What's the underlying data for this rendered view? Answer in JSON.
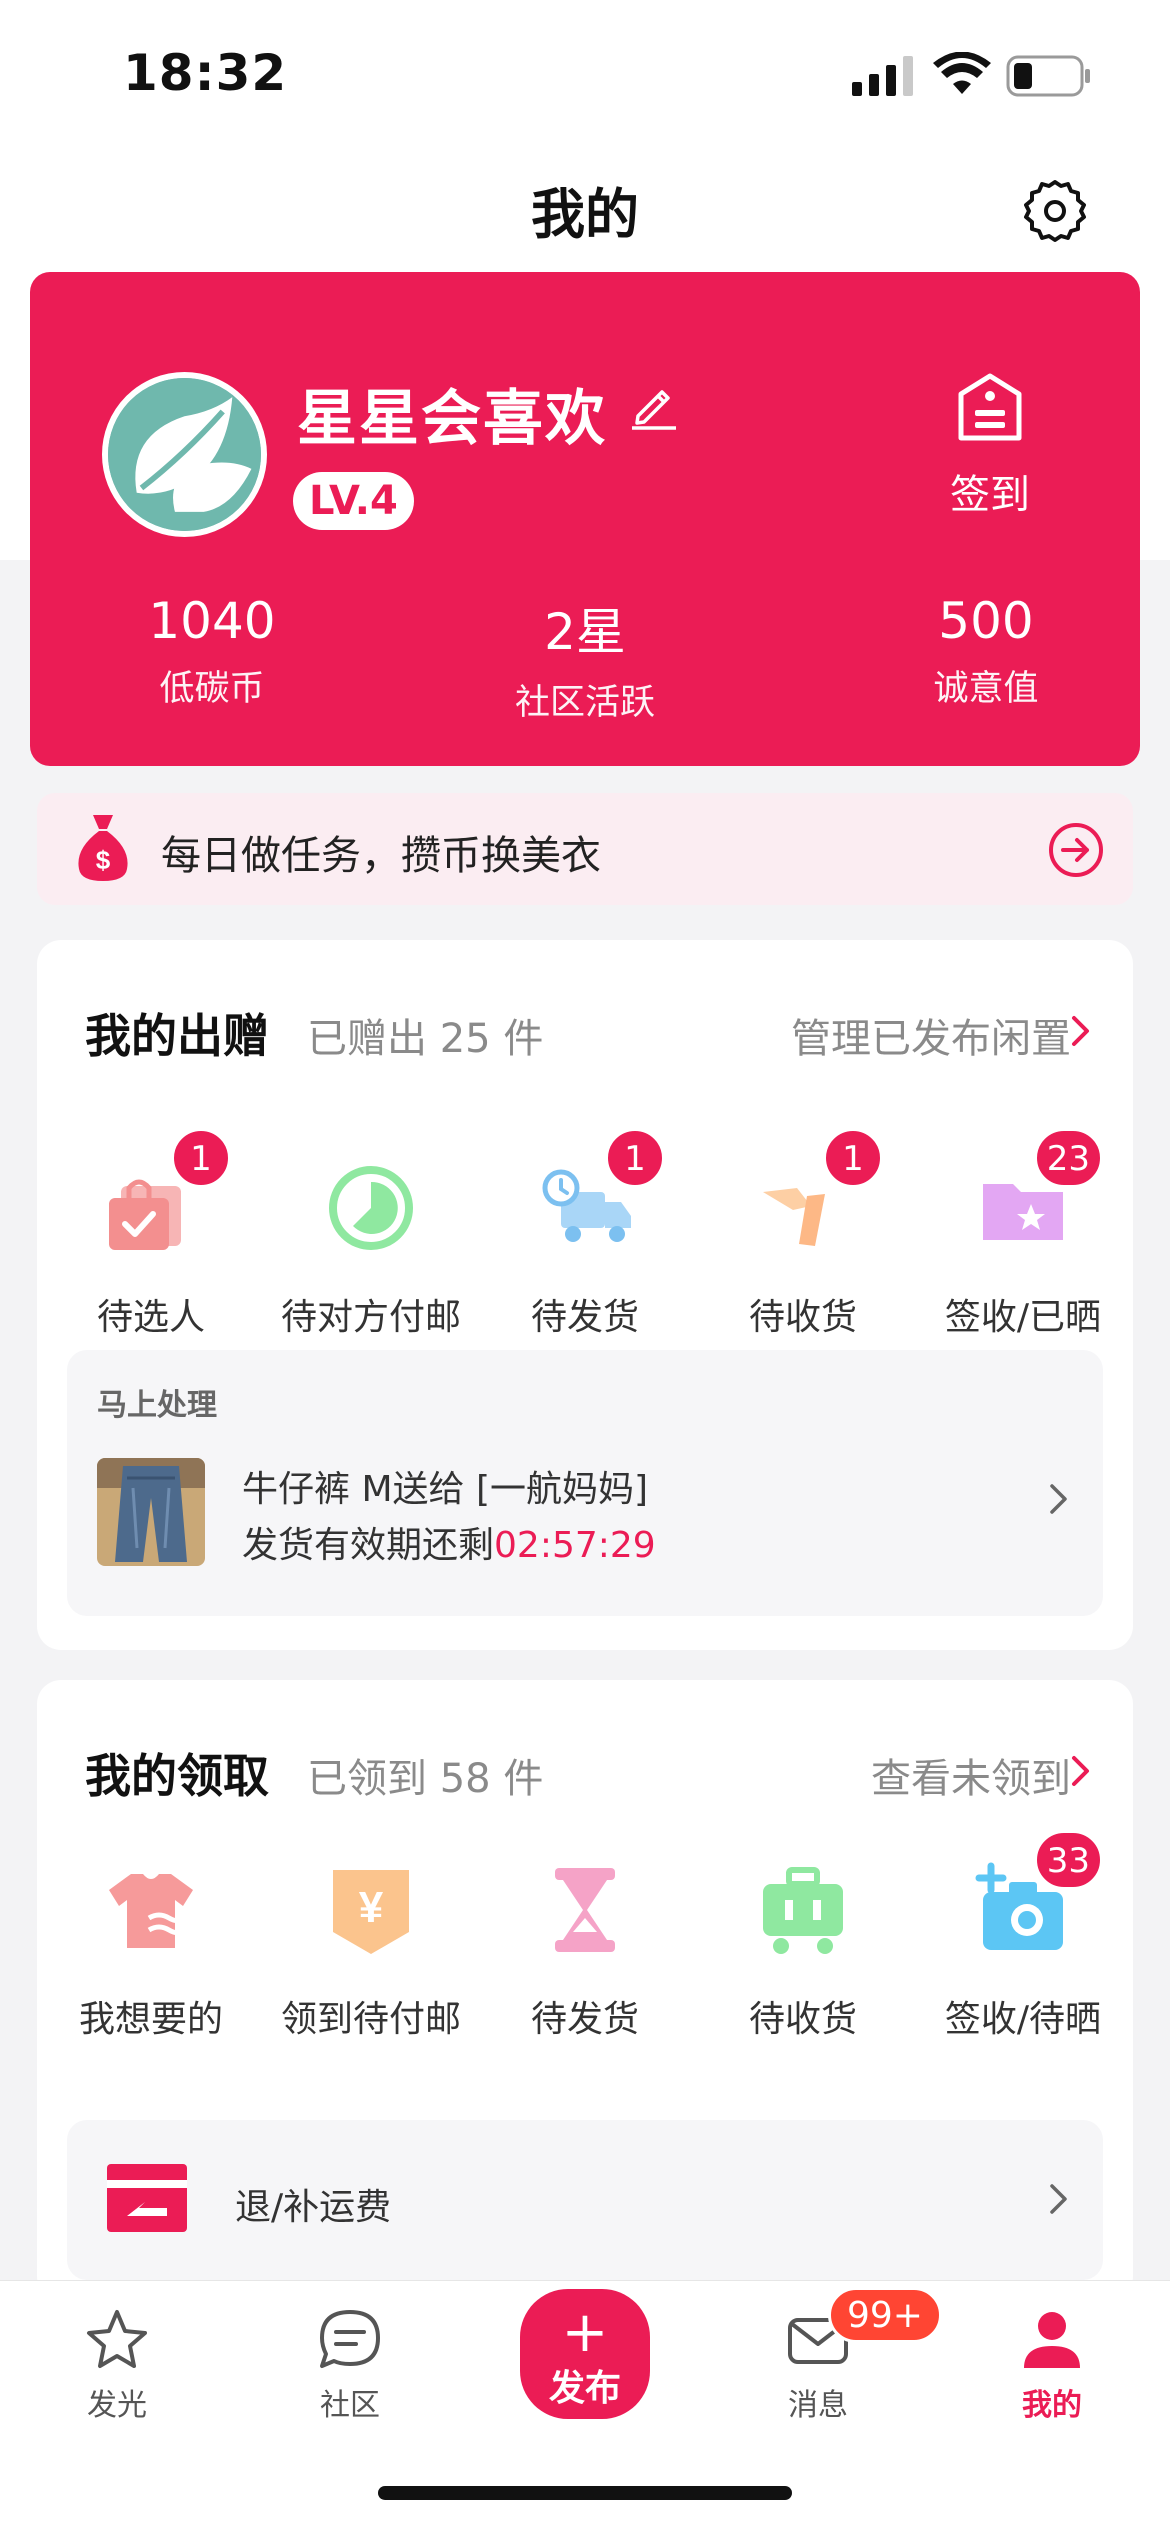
{
  "status_bar": {
    "time": "18:32"
  },
  "nav": {
    "title": "我的"
  },
  "profile": {
    "username": "星星会喜欢",
    "level": "LV.4",
    "checkin_label": "签到",
    "stats": [
      {
        "value": "1040",
        "label": "低碳币"
      },
      {
        "value": "2星",
        "label": "社区活跃"
      },
      {
        "value": "500",
        "label": "诚意值"
      }
    ]
  },
  "banner": {
    "text": "每日做任务，攒币换美衣"
  },
  "give": {
    "title": "我的出赠",
    "subtitle": "已赠出 25 件",
    "link": "管理已发布闲置",
    "items": [
      {
        "label": "待选人",
        "badge": "1",
        "icon": "bag-check-icon"
      },
      {
        "label": "待对方付邮",
        "badge": "",
        "icon": "timer-circle-icon"
      },
      {
        "label": "待发货",
        "badge": "1",
        "icon": "delivery-truck-icon"
      },
      {
        "label": "待收货",
        "badge": "1",
        "icon": "handshake-icon"
      },
      {
        "label": "签收/已晒",
        "badge": "23",
        "icon": "star-folder-icon"
      }
    ],
    "task": {
      "heading": "马上处理",
      "title": "牛仔裤 M送给 [一航妈妈]",
      "deadline_prefix": "发货有效期还剩",
      "deadline_time": "02:57:29"
    }
  },
  "get": {
    "title": "我的领取",
    "subtitle": "已领到 58 件",
    "link": "查看未领到",
    "items": [
      {
        "label": "我想要的",
        "badge": "",
        "icon": "tshirt-icon"
      },
      {
        "label": "领到待付邮",
        "badge": "",
        "icon": "yen-tag-icon"
      },
      {
        "label": "待发货",
        "badge": "",
        "icon": "hourglass-icon"
      },
      {
        "label": "待收货",
        "badge": "",
        "icon": "cart-icon"
      },
      {
        "label": "签收/待晒",
        "badge": "33",
        "icon": "camera-plus-icon"
      }
    ],
    "refund_label": "退/补运费"
  },
  "tabs": {
    "items": [
      {
        "label": "发光",
        "icon": "star-icon"
      },
      {
        "label": "社区",
        "icon": "chat-bubble-icon"
      },
      {
        "label": "发布",
        "icon": "plus-icon"
      },
      {
        "label": "消息",
        "icon": "mail-icon",
        "badge": "99+"
      },
      {
        "label": "我的",
        "icon": "person-icon"
      }
    ],
    "publish_plus": "+"
  },
  "colors": {
    "primary": "#eb1c55",
    "badge_red": "#ff4533"
  }
}
